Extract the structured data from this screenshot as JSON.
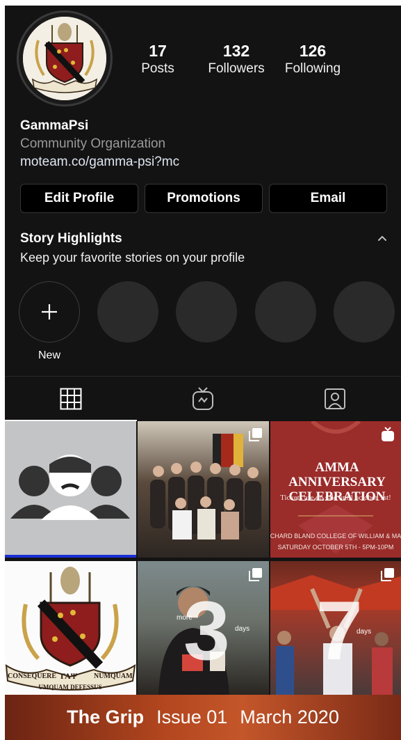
{
  "profile": {
    "posts_count": "17",
    "posts_label": "Posts",
    "followers_count": "132",
    "followers_label": "Followers",
    "following_count": "126",
    "following_label": "Following",
    "name": "GammaPsi",
    "category": "Community Organization",
    "link": "moteam.co/gamma-psi?mc",
    "logo_text_left": "CONSEQUERE",
    "logo_text_mid": "ΓΑΨ",
    "logo_text_right": "NUMQUAM",
    "logo_banner": "UMQUAM DEFESSUS"
  },
  "buttons": {
    "edit_profile": "Edit Profile",
    "promotions": "Promotions",
    "email": "Email"
  },
  "highlights": {
    "title": "Story Highlights",
    "subtitle": "Keep your favorite stories on your profile",
    "new_label": "New"
  },
  "posts": {
    "anniversary_title_1": "AMMA ANNIVERSARY",
    "anniversary_title_2": "CELEBRATION",
    "anniversary_tickets": "Tickets are on sale until october 1st!",
    "anniversary_venue": "CHARD BLAND COLLEGE OF WILLIAM & MA",
    "anniversary_date": "SATURDAY OCTOBER 5TH - 5PM-10PM",
    "countdown_3_num": "3",
    "countdown_3_days": "days",
    "countdown_3_more": "more",
    "countdown_7_num": "7",
    "countdown_7_days": "days"
  },
  "banner": {
    "title": "The Grip",
    "issue": "Issue 01",
    "date": "March 2020"
  },
  "colors": {
    "background": "#131313",
    "button_bg": "#000000",
    "banner": "#b2461e",
    "crest_red": "#8f1d1d"
  }
}
